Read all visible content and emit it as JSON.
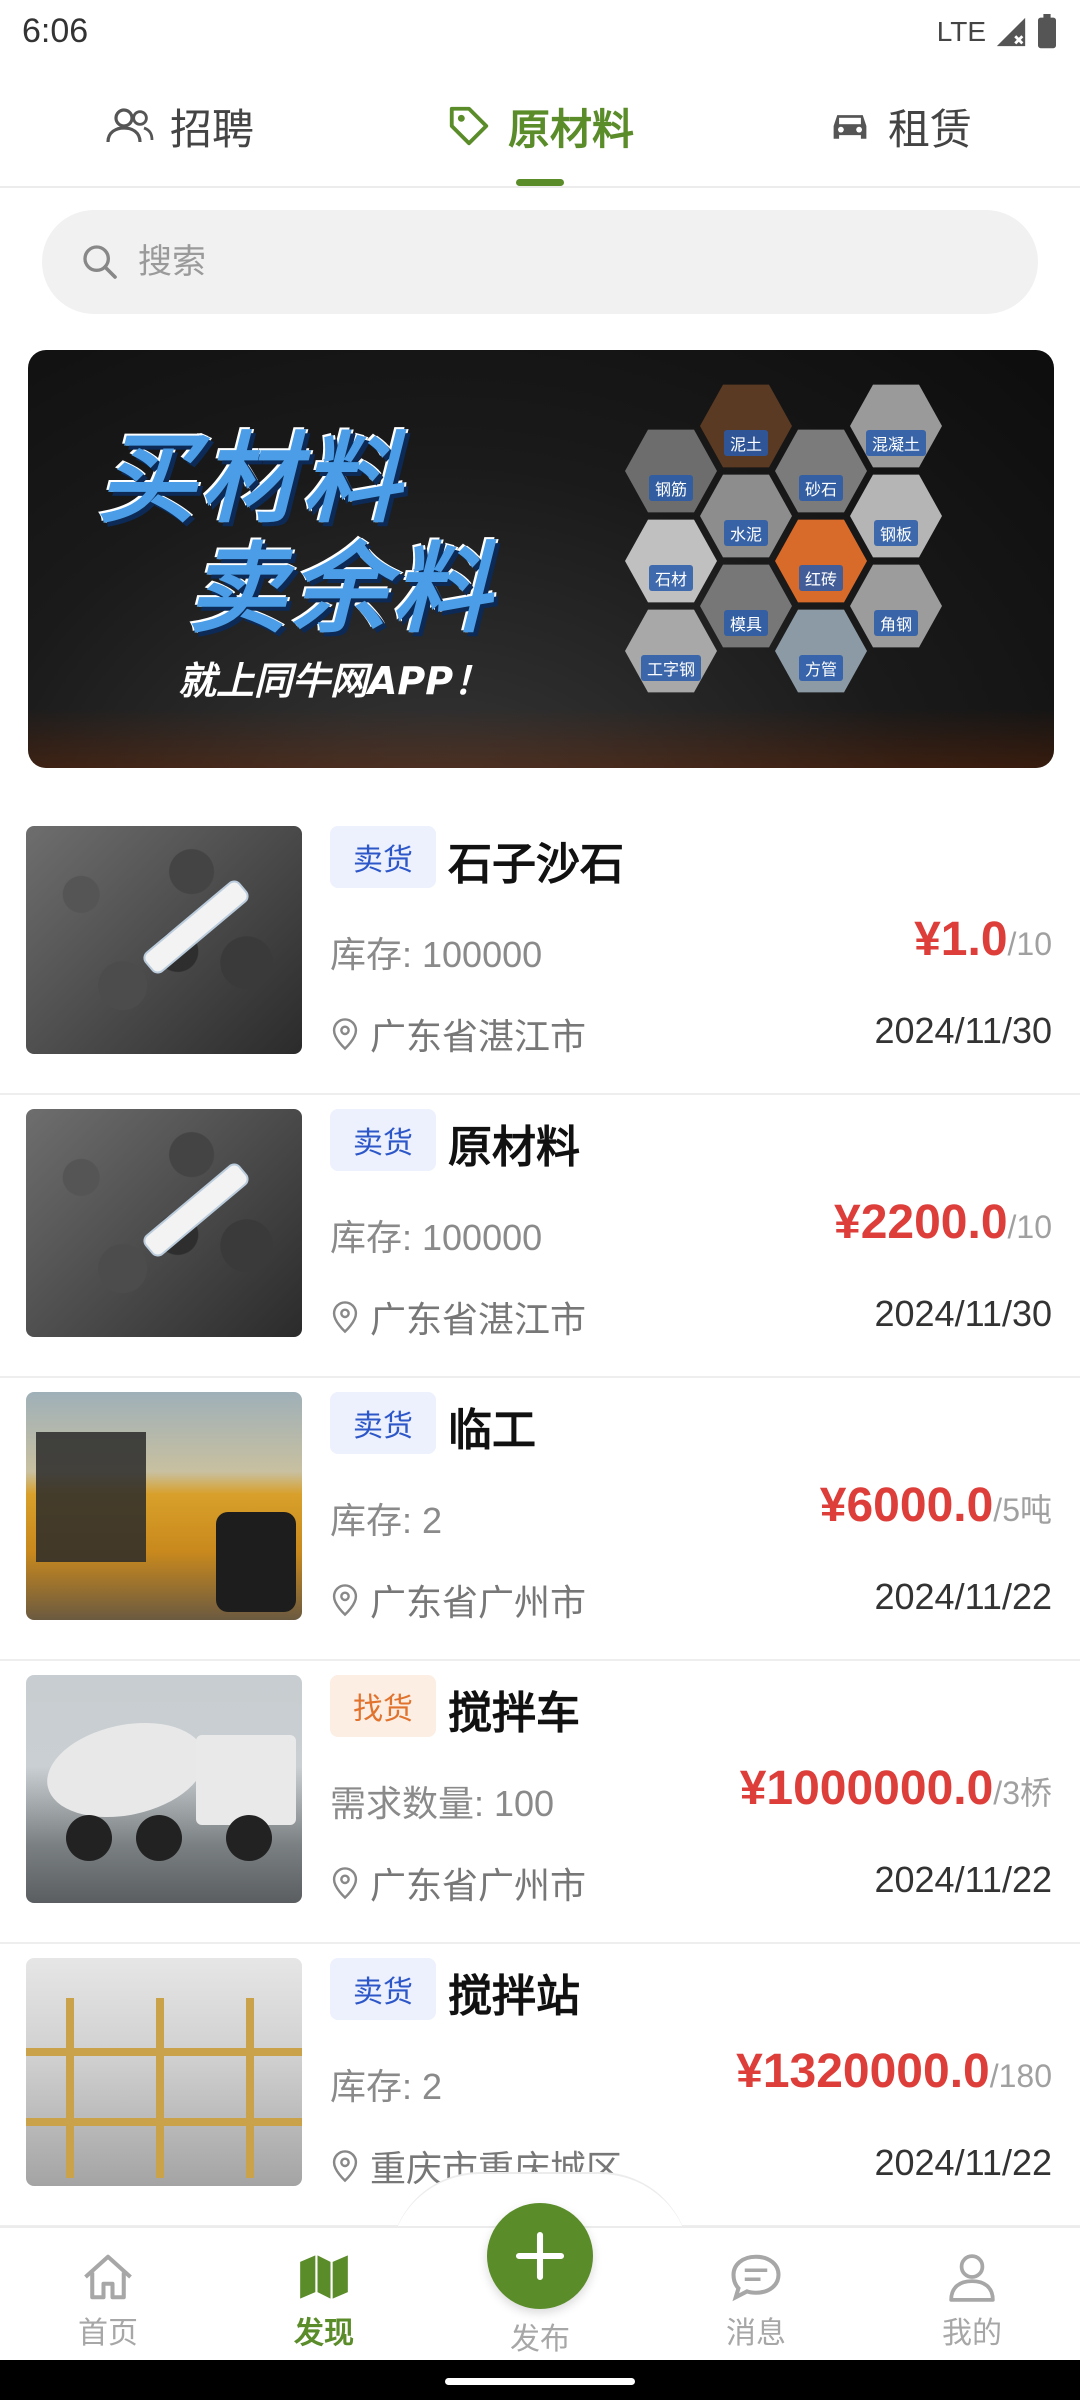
{
  "status_bar": {
    "time": "6:06",
    "network": "LTE"
  },
  "top_tabs": [
    {
      "label": "招聘",
      "icon": "people-icon",
      "active": false
    },
    {
      "label": "原材料",
      "icon": "tag-icon",
      "active": true
    },
    {
      "label": "租赁",
      "icon": "car-icon",
      "active": false
    }
  ],
  "search": {
    "placeholder": "搜索"
  },
  "banner": {
    "line1": "买材料",
    "line2": "卖余料",
    "subtitle": "就上同牛网APP！",
    "materials": [
      "泥土",
      "混凝土",
      "钢筋",
      "砂石",
      "水泥",
      "钢板",
      "石材",
      "红砖",
      "模具",
      "角钢",
      "工字钢",
      "方管"
    ]
  },
  "listings": [
    {
      "tag": "卖货",
      "tag_type": "sell",
      "title": "石子沙石",
      "qty_label": "库存: 100000",
      "price": "¥1.0",
      "unit": "/10",
      "location": "广东省湛江市",
      "date": "2024/11/30",
      "image": "coal"
    },
    {
      "tag": "卖货",
      "tag_type": "sell",
      "title": "原材料",
      "qty_label": "库存: 100000",
      "price": "¥2200.0",
      "unit": "/10",
      "location": "广东省湛江市",
      "date": "2024/11/30",
      "image": "coal"
    },
    {
      "tag": "卖货",
      "tag_type": "sell",
      "title": "临工",
      "qty_label": "库存: 2",
      "price": "¥6000.0",
      "unit": "/5吨",
      "location": "广东省广州市",
      "date": "2024/11/22",
      "image": "loader"
    },
    {
      "tag": "找货",
      "tag_type": "buy",
      "title": "搅拌车",
      "qty_label": "需求数量: 100",
      "price": "¥1000000.0",
      "unit": "/3桥",
      "location": "广东省广州市",
      "date": "2024/11/22",
      "image": "mixer"
    },
    {
      "tag": "卖货",
      "tag_type": "sell",
      "title": "搅拌站",
      "qty_label": "库存: 2",
      "price": "¥1320000.0",
      "unit": "/180",
      "location": "重庆市重庆城区",
      "date": "2024/11/22",
      "image": "plant"
    }
  ],
  "bottom_nav": [
    {
      "label": "首页",
      "icon": "home-icon",
      "active": false
    },
    {
      "label": "发现",
      "icon": "map-icon",
      "active": true
    },
    {
      "label": "发布",
      "icon": "plus-icon",
      "active": false
    },
    {
      "label": "消息",
      "icon": "chat-icon",
      "active": false
    },
    {
      "label": "我的",
      "icon": "user-icon",
      "active": false
    }
  ],
  "colors": {
    "accent": "#5b8c2a",
    "price": "#dd3e3a",
    "sell_tag": "#2d57c8",
    "buy_tag": "#e0732d"
  }
}
